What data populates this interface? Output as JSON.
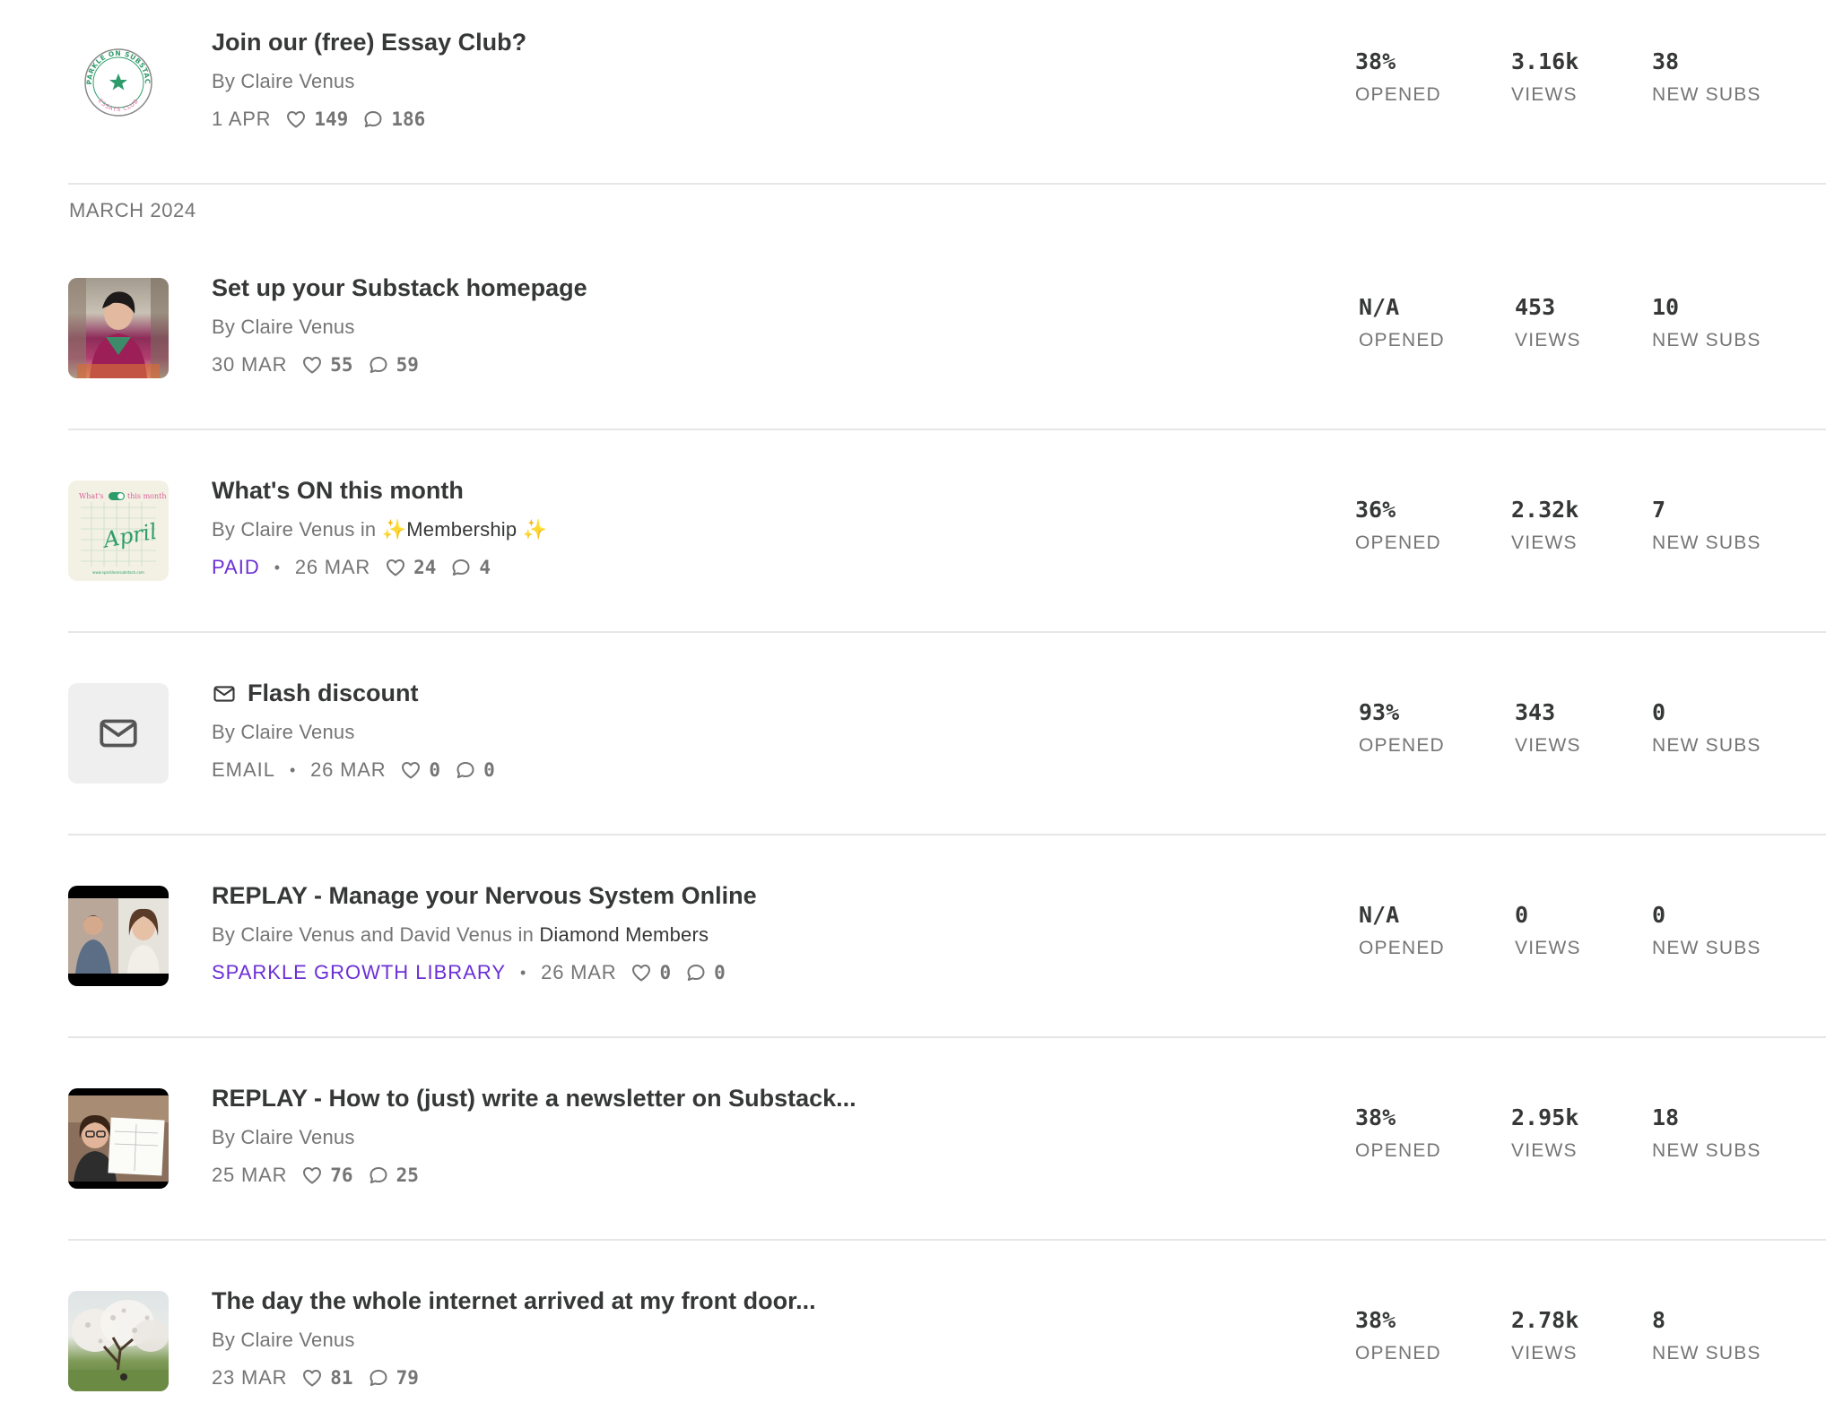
{
  "section_label": "MARCH 2024",
  "colors": {
    "accent_purple": "#6b2fd6",
    "text": "#363737",
    "muted": "#757575",
    "divider": "#e6e6e6"
  },
  "posts": [
    {
      "title": "Join our (free) Essay Club?",
      "byline": "By Claire Venus",
      "date": "1 APR",
      "likes": "149",
      "comments": "186",
      "thumbnail": "sparkle-on-substack-logo",
      "stats": {
        "opened": "38%",
        "views": "3.16k",
        "new_subs": "38"
      }
    },
    {
      "title": "Set up your Substack homepage",
      "byline": "By Claire Venus",
      "date": "30 MAR",
      "likes": "55",
      "comments": "59",
      "thumbnail": "photo-woman-at-desk",
      "stats": {
        "opened": "N/A",
        "views": "453",
        "new_subs": "10"
      }
    },
    {
      "title": "What's ON this month",
      "byline_prefix": "By Claire Venus in ",
      "publication": "✨Membership ✨",
      "tag": "PAID",
      "date": "26 MAR",
      "likes": "24",
      "comments": "4",
      "thumbnail": "whats-on-this-month-graphic",
      "thumb_text": {
        "top_left": "What's",
        "top_right": "this month",
        "script": "April",
        "footer": "www.sparkleonsubstack.com"
      },
      "stats": {
        "opened": "36%",
        "views": "2.32k",
        "new_subs": "7"
      }
    },
    {
      "title": "Flash discount",
      "byline": "By Claire Venus",
      "tag": "EMAIL",
      "date": "26 MAR",
      "likes": "0",
      "comments": "0",
      "thumbnail": "mail-icon",
      "stats": {
        "opened": "93%",
        "views": "343",
        "new_subs": "0"
      }
    },
    {
      "title": "REPLAY - Manage your Nervous System Online",
      "byline_prefix": "By Claire Venus and David Venus in ",
      "publication": "Diamond Members",
      "tag": "SPARKLE GROWTH LIBRARY",
      "date": "26 MAR",
      "likes": "0",
      "comments": "0",
      "thumbnail": "video-call-two-people",
      "stats": {
        "opened": "N/A",
        "views": "0",
        "new_subs": "0"
      }
    },
    {
      "title": "REPLAY - How to (just) write a newsletter on Substack...",
      "byline": "By Claire Venus",
      "date": "25 MAR",
      "likes": "76",
      "comments": "25",
      "thumbnail": "video-woman-holding-paper",
      "stats": {
        "opened": "38%",
        "views": "2.95k",
        "new_subs": "18"
      }
    },
    {
      "title": "The day the whole internet arrived at my front door...",
      "byline": "By Claire Venus",
      "date": "23 MAR",
      "likes": "81",
      "comments": "79",
      "thumbnail": "photo-blossom-tree",
      "stats": {
        "opened": "38%",
        "views": "2.78k",
        "new_subs": "8"
      }
    }
  ],
  "stat_labels": {
    "opened": "OPENED",
    "views": "VIEWS",
    "new_subs": "NEW SUBS"
  },
  "logo_text": {
    "top": "SPARKLE ON SUBSTACK",
    "bottom": "ESSAYS CLUB"
  }
}
